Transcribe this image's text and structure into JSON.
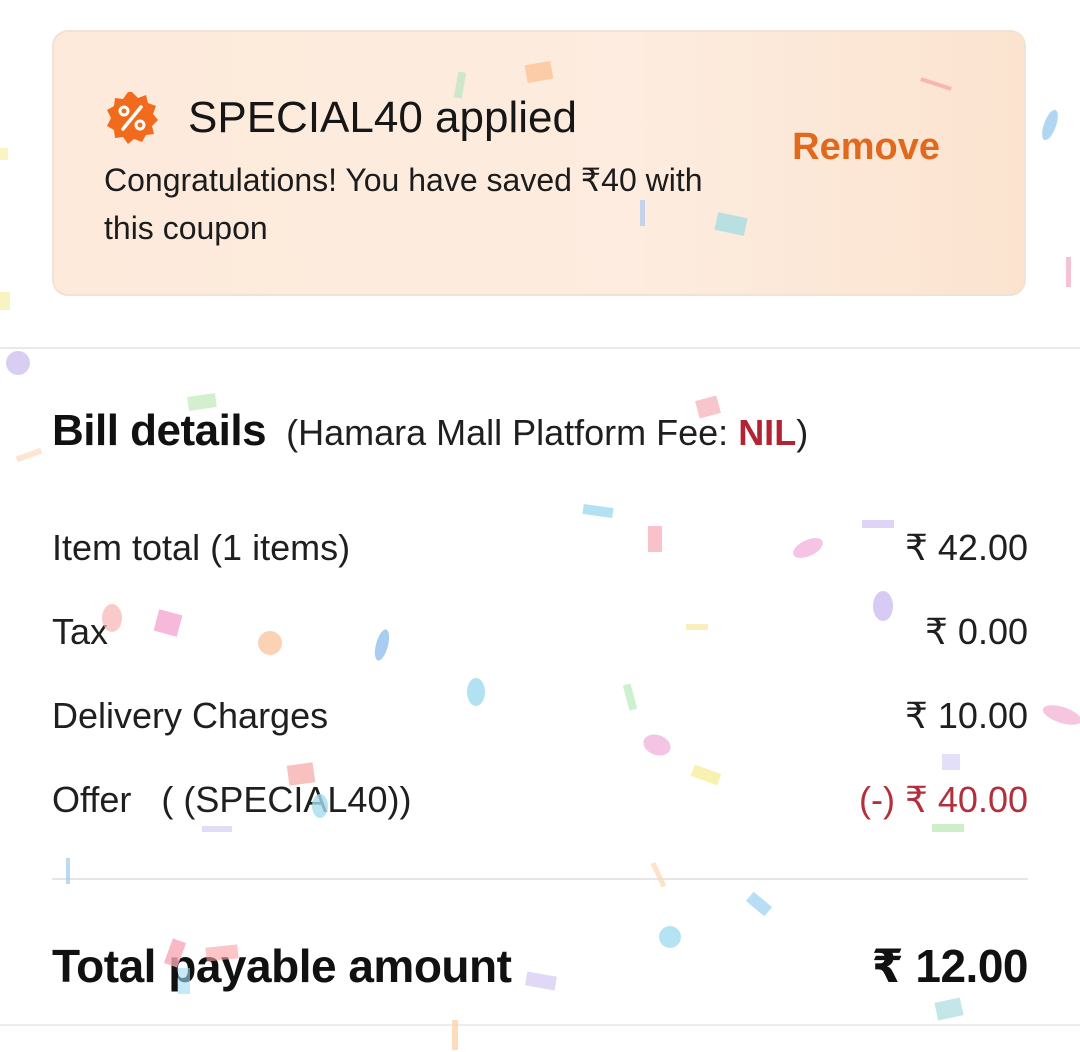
{
  "coupon": {
    "code_applied": "SPECIAL40 applied",
    "message": "Congratulations! You have saved ₹40 with this coupon",
    "remove_label": "Remove",
    "badge_icon": "percent-badge-icon",
    "badge_color": "#f26a1b"
  },
  "bill": {
    "title": "Bill details",
    "platform_fee_prefix": "(Hamara Mall Platform Fee: ",
    "platform_fee_value": "NIL",
    "platform_fee_suffix": ")",
    "rows": [
      {
        "label": "Item total (1 items)",
        "value": "₹ 42.00"
      },
      {
        "label": "Tax",
        "value": "₹ 0.00"
      },
      {
        "label": "Delivery Charges",
        "value": "₹ 10.00"
      },
      {
        "label": "Offer   ( (SPECIAL40))",
        "value": "(-) ₹ 40.00"
      }
    ],
    "total_label": "Total payable amount",
    "total_value": "₹ 12.00"
  },
  "colors": {
    "accent_orange": "#e0691e",
    "discount_red": "#b2303c",
    "card_background": "#fdeadb"
  }
}
